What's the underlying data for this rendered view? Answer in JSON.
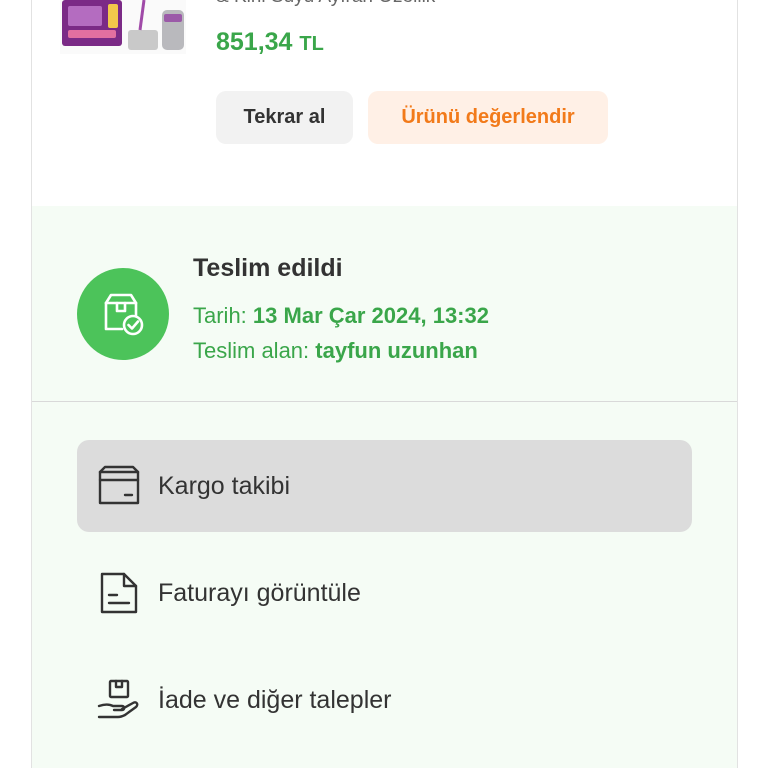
{
  "product": {
    "title_partial": "& Kirli Suyu Ayıran Özellik",
    "price_value": "851,34",
    "price_currency": "TL",
    "rebuy_label": "Tekrar al",
    "review_label": "Ürünü değerlendir"
  },
  "delivery": {
    "status_title": "Teslim edildi",
    "date_label": "Tarih:",
    "date_value": "13 Mar Çar 2024, 13:32",
    "receiver_label": "Teslim alan:",
    "receiver_value": "tayfun uzunhan"
  },
  "actions": [
    {
      "label": "Kargo takibi",
      "icon": "box-icon"
    },
    {
      "label": "Faturayı görüntüle",
      "icon": "invoice-icon"
    },
    {
      "label": "İade ve diğer talepler",
      "icon": "return-hand-icon"
    }
  ],
  "colors": {
    "price_green": "#3aa64a",
    "status_green": "#4cc35a",
    "orange": "#f27a1a",
    "panel_bg": "#f5fcf5"
  }
}
